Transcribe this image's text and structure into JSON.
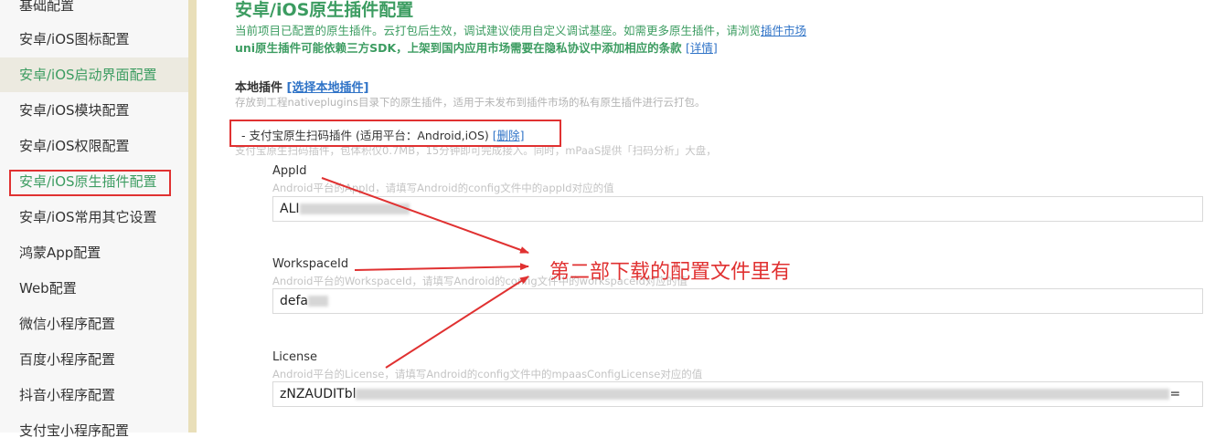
{
  "sidebar": {
    "items": [
      {
        "label": "基础配置"
      },
      {
        "label": "安卓/iOS图标配置"
      },
      {
        "label": "安卓/iOS启动界面配置"
      },
      {
        "label": "安卓/iOS模块配置"
      },
      {
        "label": "安卓/iOS权限配置"
      },
      {
        "label": "安卓/iOS原生插件配置"
      },
      {
        "label": "安卓/iOS常用其它设置"
      },
      {
        "label": "鸿蒙App配置"
      },
      {
        "label": "Web配置"
      },
      {
        "label": "微信小程序配置"
      },
      {
        "label": "百度小程序配置"
      },
      {
        "label": "抖音小程序配置"
      },
      {
        "label": "支付宝小程序配置"
      }
    ]
  },
  "main": {
    "title": "安卓/iOS原生插件配置",
    "desc_prefix": "当前项目已配置的原生插件。云打包后生效，调试建议使用自定义调试基座。如需更多原生插件，请浏览",
    "plugin_market_link": "插件市场",
    "warning": "uni原生插件可能依赖三方SDK，上架到国内应用市场需要在隐私协议中添加相应的条款",
    "details_link": "[详情]",
    "local_plugins_label": "本地插件",
    "select_local_link": "[选择本地插件]",
    "local_plugins_desc": "存放到工程nativeplugins目录下的原生插件，适用于未发布到插件市场的私有原生插件进行云打包。",
    "plugin": {
      "name": "- 支付宝原生扫码插件 (适用平台：Android,iOS)",
      "delete_link": "[删除]",
      "desc": "支付宝原生扫码插件，包体积仅0.7MB，15分钟即可完成接入。同时，mPaaS提供「扫码分析」大盘，"
    },
    "fields": [
      {
        "label": "AppId",
        "hint": "Android平台的AppId，请填写Android的config文件中的appId对应的值",
        "value": "ALI"
      },
      {
        "label": "WorkspaceId",
        "hint": "Android平台的WorkspaceId，请填写Android的config文件中的workspaceId对应的值",
        "value": "defa"
      },
      {
        "label": "License",
        "hint": "Android平台的License，请填写Android的config文件中的mpaasConfigLicense对应的值",
        "value": "zNZAUDITbl",
        "value_end": "="
      }
    ]
  },
  "annotation": {
    "text": "第二部下载的配置文件里有",
    "color": "#e03131"
  }
}
